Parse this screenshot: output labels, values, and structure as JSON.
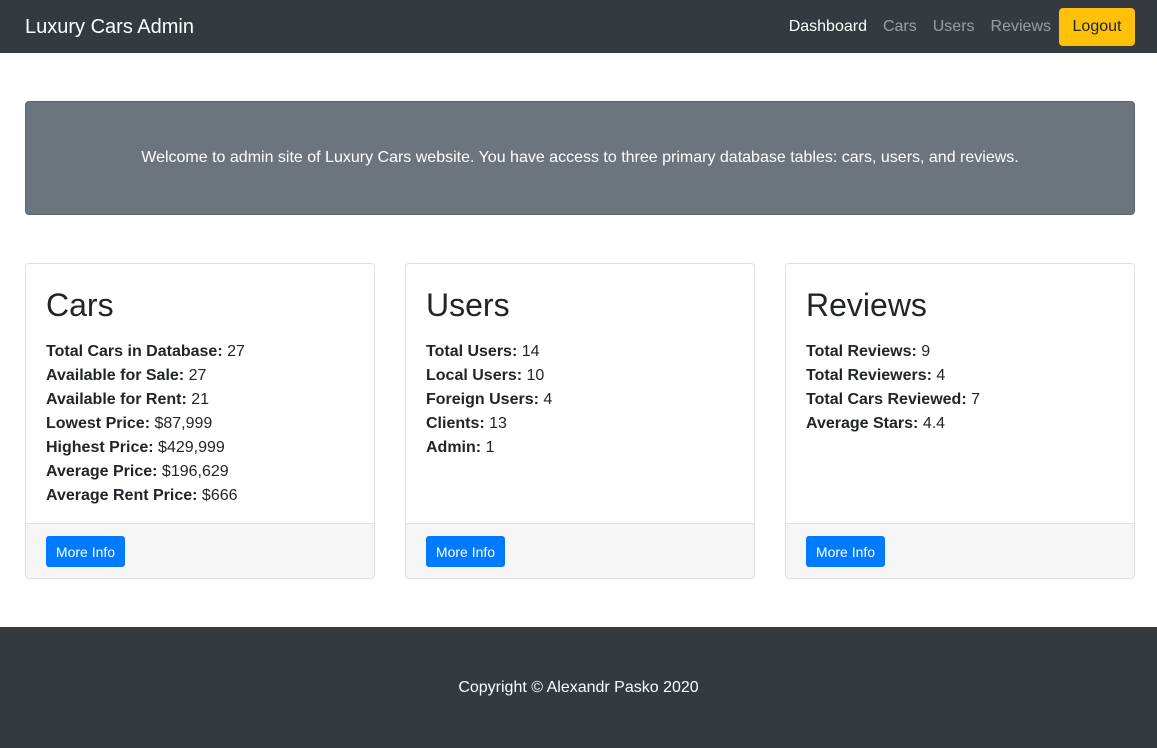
{
  "navbar": {
    "brand": "Luxury Cars Admin",
    "links": [
      {
        "label": "Dashboard",
        "active": true
      },
      {
        "label": "Cars",
        "active": false
      },
      {
        "label": "Users",
        "active": false
      },
      {
        "label": "Reviews",
        "active": false
      }
    ],
    "logout_label": "Logout"
  },
  "welcome": {
    "text": "Welcome to admin site of Luxury Cars website. You have access to three primary database tables: cars, users, and reviews."
  },
  "cards": [
    {
      "title": "Cars",
      "stats": [
        {
          "label": "Total Cars in Database:",
          "value": "27"
        },
        {
          "label": "Available for Sale:",
          "value": "27"
        },
        {
          "label": "Available for Rent:",
          "value": "21"
        },
        {
          "label": "Lowest Price:",
          "value": "$87,999"
        },
        {
          "label": "Highest Price:",
          "value": "$429,999"
        },
        {
          "label": "Average Price:",
          "value": "$196,629"
        },
        {
          "label": "Average Rent Price:",
          "value": "$666"
        }
      ],
      "button_label": "More Info"
    },
    {
      "title": "Users",
      "stats": [
        {
          "label": "Total Users:",
          "value": "14"
        },
        {
          "label": "Local Users:",
          "value": "10"
        },
        {
          "label": "Foreign Users:",
          "value": "4"
        },
        {
          "label": "Clients:",
          "value": "13"
        },
        {
          "label": "Admin:",
          "value": "1"
        }
      ],
      "button_label": "More Info"
    },
    {
      "title": "Reviews",
      "stats": [
        {
          "label": "Total Reviews:",
          "value": "9"
        },
        {
          "label": "Total Reviewers:",
          "value": "4"
        },
        {
          "label": "Total Cars Reviewed:",
          "value": "7"
        },
        {
          "label": "Average Stars:",
          "value": "4.4"
        }
      ],
      "button_label": "More Info"
    }
  ],
  "footer": {
    "text": "Copyright © Alexandr Pasko 2020"
  },
  "colors": {
    "navbar_bg": "#343a40",
    "jumbotron_bg": "#6c757d",
    "logout_bg": "#ffc107",
    "primary_button": "#007bff"
  }
}
